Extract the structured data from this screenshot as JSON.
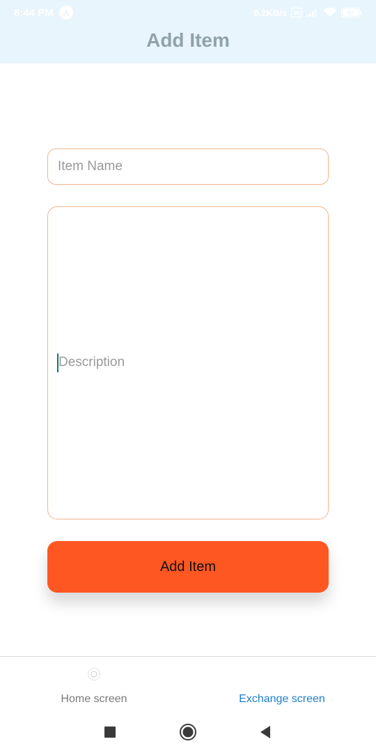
{
  "status_bar": {
    "time": "8:44 PM",
    "network_speed": "0.2KB/s",
    "battery": "92",
    "icons": [
      "a-app-icon",
      "vowifi-icon",
      "signal-icon",
      "wifi-icon",
      "battery-icon"
    ]
  },
  "header": {
    "title": "Add Item"
  },
  "form": {
    "item_name_placeholder": "Item Name",
    "description_placeholder": "Description",
    "submit_label": "Add Item"
  },
  "tabs": [
    {
      "label": "Home screen",
      "icon": "home-tab-icon",
      "active": false
    },
    {
      "label": "Exchange screen",
      "icon": "exchange-tab-icon",
      "active": true
    }
  ],
  "nav": {
    "icons": [
      "recents-icon",
      "home-icon",
      "back-icon"
    ]
  },
  "colors": {
    "header_bg": "#e9f5fc",
    "title": "#8fa3a8",
    "input_border": "#f2b38e",
    "button": "#ff5722",
    "active_tab": "#1e7fc9",
    "inactive_tab": "#7a7a7a",
    "caret": "#0f7a6b"
  }
}
